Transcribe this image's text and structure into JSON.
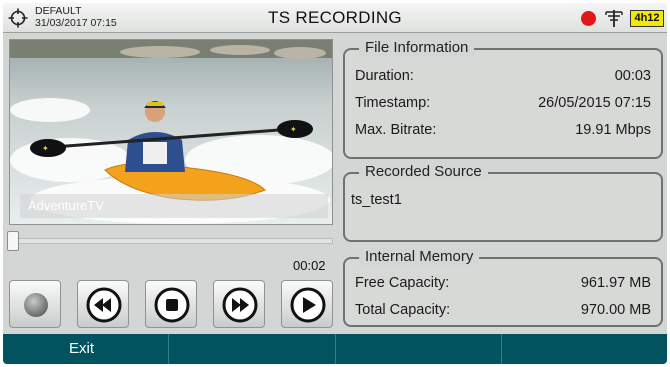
{
  "header": {
    "profile_name": "DEFAULT",
    "datetime": "31/03/2017 07:15",
    "title": "TS RECORDING",
    "record_status_color": "#e01818",
    "battery_label": "4h12",
    "icons": [
      "target-icon",
      "record-indicator-icon",
      "antenna-icon",
      "battery-icon"
    ]
  },
  "player": {
    "channel_label": "AdventureTV",
    "elapsed_time": "00:02",
    "progress_fraction": 0.0,
    "buttons": [
      {
        "name": "record-toggle-button",
        "icon": "disc-icon"
      },
      {
        "name": "rewind-button",
        "icon": "rewind-icon"
      },
      {
        "name": "stop-button",
        "icon": "stop-icon"
      },
      {
        "name": "fast-forward-button",
        "icon": "fast-forward-icon"
      },
      {
        "name": "play-button",
        "icon": "play-icon"
      }
    ]
  },
  "file_information": {
    "title": "File Information",
    "duration_label": "Duration:",
    "duration_value": "00:03",
    "timestamp_label": "Timestamp:",
    "timestamp_value": "26/05/2015 07:15",
    "bitrate_label": "Max. Bitrate:",
    "bitrate_value": "19.91 Mbps"
  },
  "recorded_source": {
    "title": "Recorded Source",
    "value": "ts_test1"
  },
  "internal_memory": {
    "title": "Internal Memory",
    "free_label": "Free Capacity:",
    "free_value": "961.97 MB",
    "total_label": "Total Capacity:",
    "total_value": "970.00 MB"
  },
  "softkeys": [
    "Exit",
    "",
    "",
    ""
  ],
  "colors": {
    "softkey_bar": "#00535f",
    "screen_background": "#d3d6d4",
    "battery": "#f3e800"
  }
}
